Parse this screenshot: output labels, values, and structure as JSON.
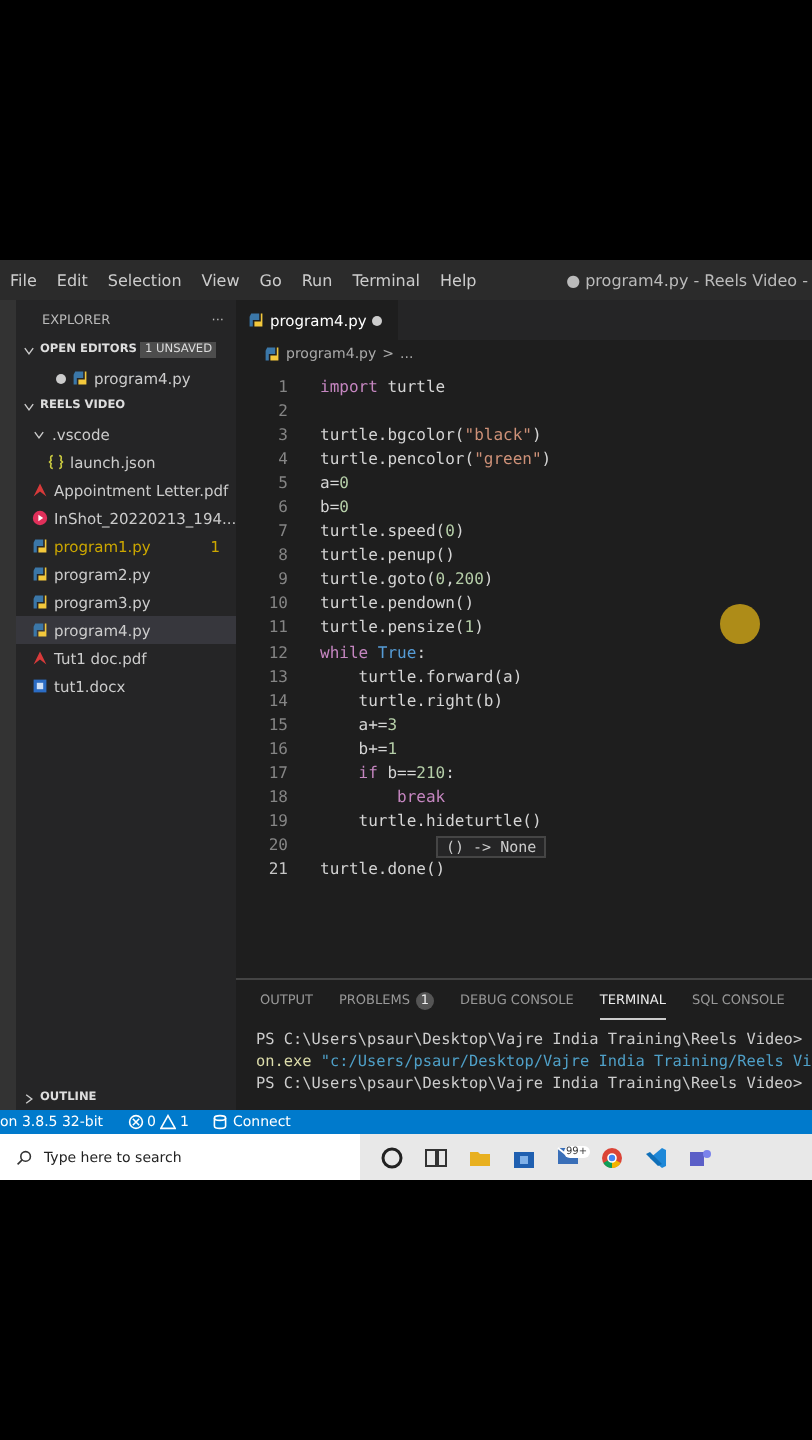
{
  "menu": [
    "File",
    "Edit",
    "Selection",
    "View",
    "Go",
    "Run",
    "Terminal",
    "Help"
  ],
  "window": {
    "title": "● program4.py - Reels Video -"
  },
  "sidebar": {
    "title": "EXPLORER",
    "more": "···",
    "open_editors": {
      "label": "OPEN EDITORS",
      "badge": "1 UNSAVED",
      "expanded": true,
      "items": [
        {
          "name": "program4.py",
          "kind": "python",
          "modified": true
        }
      ]
    },
    "folder": {
      "label": "REELS VIDEO",
      "expanded": true,
      "items": [
        {
          "name": ".vscode",
          "kind": "folder",
          "expanded": true,
          "selected": false,
          "warning": false,
          "children": [
            {
              "name": "launch.json",
              "kind": "json",
              "selected": false,
              "warning": false
            }
          ]
        },
        {
          "name": "Appointment Letter.pdf",
          "kind": "pdf",
          "selected": false,
          "warning": false
        },
        {
          "name": "InShot_20220213_194...",
          "kind": "video",
          "selected": false,
          "warning": false
        },
        {
          "name": "program1.py",
          "kind": "python",
          "selected": false,
          "warning": true,
          "badge": "1"
        },
        {
          "name": "program2.py",
          "kind": "python",
          "selected": false,
          "warning": false
        },
        {
          "name": "program3.py",
          "kind": "python",
          "selected": false,
          "warning": false
        },
        {
          "name": "program4.py",
          "kind": "python",
          "selected": true,
          "warning": false
        },
        {
          "name": "Tut1 doc.pdf",
          "kind": "pdf",
          "selected": false,
          "warning": false
        },
        {
          "name": "tut1.docx",
          "kind": "word",
          "selected": false,
          "warning": false
        }
      ]
    },
    "outline": {
      "label": "OUTLINE",
      "expanded": false
    }
  },
  "tabs": [
    {
      "label": "program4.py",
      "selected": true,
      "modified": true
    }
  ],
  "breadcrumb": [
    "program4.py",
    ">",
    "..."
  ],
  "code": [
    {
      "number": "1",
      "current": false,
      "tokens": [
        {
          "kind": "keyword",
          "text": "import"
        },
        {
          "kind": "text",
          "text": " turtle"
        }
      ]
    },
    {
      "number": "2",
      "current": false
    },
    {
      "number": "3",
      "current": false,
      "tokens": [
        {
          "kind": "text",
          "text": "turtle.bgcolor("
        },
        {
          "kind": "string",
          "text": "\"black\""
        },
        {
          "kind": "text",
          "text": ")"
        }
      ]
    },
    {
      "number": "4",
      "current": false,
      "tokens": [
        {
          "kind": "text",
          "text": "turtle.pencolor("
        },
        {
          "kind": "string",
          "text": "\"green\""
        },
        {
          "kind": "text",
          "text": ")"
        }
      ]
    },
    {
      "number": "5",
      "current": false,
      "tokens": [
        {
          "kind": "text",
          "text": "a="
        },
        {
          "kind": "number",
          "text": "0"
        }
      ]
    },
    {
      "number": "6",
      "current": false,
      "tokens": [
        {
          "kind": "text",
          "text": "b="
        },
        {
          "kind": "number",
          "text": "0"
        }
      ]
    },
    {
      "number": "7",
      "current": false,
      "tokens": [
        {
          "kind": "text",
          "text": "turtle.speed("
        },
        {
          "kind": "number",
          "text": "0"
        },
        {
          "kind": "text",
          "text": ")"
        }
      ]
    },
    {
      "number": "8",
      "current": false,
      "tokens": [
        {
          "kind": "text",
          "text": "turtle.penup()"
        }
      ]
    },
    {
      "number": "9",
      "current": false,
      "tokens": [
        {
          "kind": "text",
          "text": "turtle.goto("
        },
        {
          "kind": "number",
          "text": "0"
        },
        {
          "kind": "text",
          "text": ","
        },
        {
          "kind": "number",
          "text": "200"
        },
        {
          "kind": "text",
          "text": ")"
        }
      ]
    },
    {
      "number": "10",
      "current": false,
      "tokens": [
        {
          "kind": "text",
          "text": "turtle.pendown()"
        }
      ]
    },
    {
      "number": "11",
      "current": false,
      "tokens": [
        {
          "kind": "text",
          "text": "turtle.pensize("
        },
        {
          "kind": "number",
          "text": "1"
        },
        {
          "kind": "text",
          "text": ")"
        }
      ]
    },
    {
      "number": "12",
      "current": false,
      "tokens": [
        {
          "kind": "keyword",
          "text": "while"
        },
        {
          "kind": "constant",
          "text": " True"
        },
        {
          "kind": "text",
          "text": ":"
        }
      ]
    },
    {
      "number": "13",
      "current": false,
      "tokens": [
        {
          "kind": "text",
          "text": "    turtle.forward(a)"
        }
      ]
    },
    {
      "number": "14",
      "current": false,
      "tokens": [
        {
          "kind": "text",
          "text": "    turtle.right(b)"
        }
      ]
    },
    {
      "number": "15",
      "current": false,
      "tokens": [
        {
          "kind": "text",
          "text": "    a+="
        },
        {
          "kind": "number",
          "text": "3"
        }
      ]
    },
    {
      "number": "16",
      "current": false,
      "tokens": [
        {
          "kind": "text",
          "text": "    b+="
        },
        {
          "kind": "number",
          "text": "1"
        }
      ]
    },
    {
      "number": "17",
      "current": false,
      "tokens": [
        {
          "kind": "keyword",
          "text": "    if"
        },
        {
          "kind": "text",
          "text": " b=="
        },
        {
          "kind": "number",
          "text": "210"
        },
        {
          "kind": "text",
          "text": ":"
        }
      ]
    },
    {
      "number": "18",
      "current": false,
      "tokens": [
        {
          "kind": "keyword",
          "text": "        break"
        }
      ]
    },
    {
      "number": "19",
      "current": false,
      "tokens": [
        {
          "kind": "text",
          "text": "    turtle.hideturtle()"
        }
      ]
    },
    {
      "number": "20",
      "current": false
    },
    {
      "number": "21",
      "current": true,
      "tokens": [
        {
          "kind": "text",
          "text": "turtle.done()"
        }
      ]
    }
  ],
  "hover": {
    "text": "() -> None"
  },
  "panel": {
    "tabs": [
      {
        "label": "OUTPUT",
        "selected": false
      },
      {
        "label": "PROBLEMS",
        "selected": false,
        "badge": "1"
      },
      {
        "label": "DEBUG CONSOLE",
        "selected": false
      },
      {
        "label": "TERMINAL",
        "selected": true
      },
      {
        "label": "SQL CONSOLE",
        "selected": false
      }
    ],
    "terminal": [
      {
        "kind": "prompt",
        "text": "PS C:\\Users\\psaur\\Desktop\\Vajre India Training\\Reels Video>"
      },
      {
        "kind": "command",
        "text": "on.exe",
        "arg": " \"c:/Users/psaur/Desktop/Vajre India Training/Reels Vi"
      },
      {
        "kind": "prompt",
        "text": "PS C:\\Users\\psaur\\Desktop\\Vajre India Training\\Reels Video>"
      }
    ]
  },
  "status_bar": {
    "interpreter": "on 3.8.5 32-bit",
    "errors": "0",
    "warnings": "1",
    "connect": "Connect"
  },
  "taskbar": {
    "search_placeholder": "Type here to search",
    "mail_badge": "99+"
  }
}
